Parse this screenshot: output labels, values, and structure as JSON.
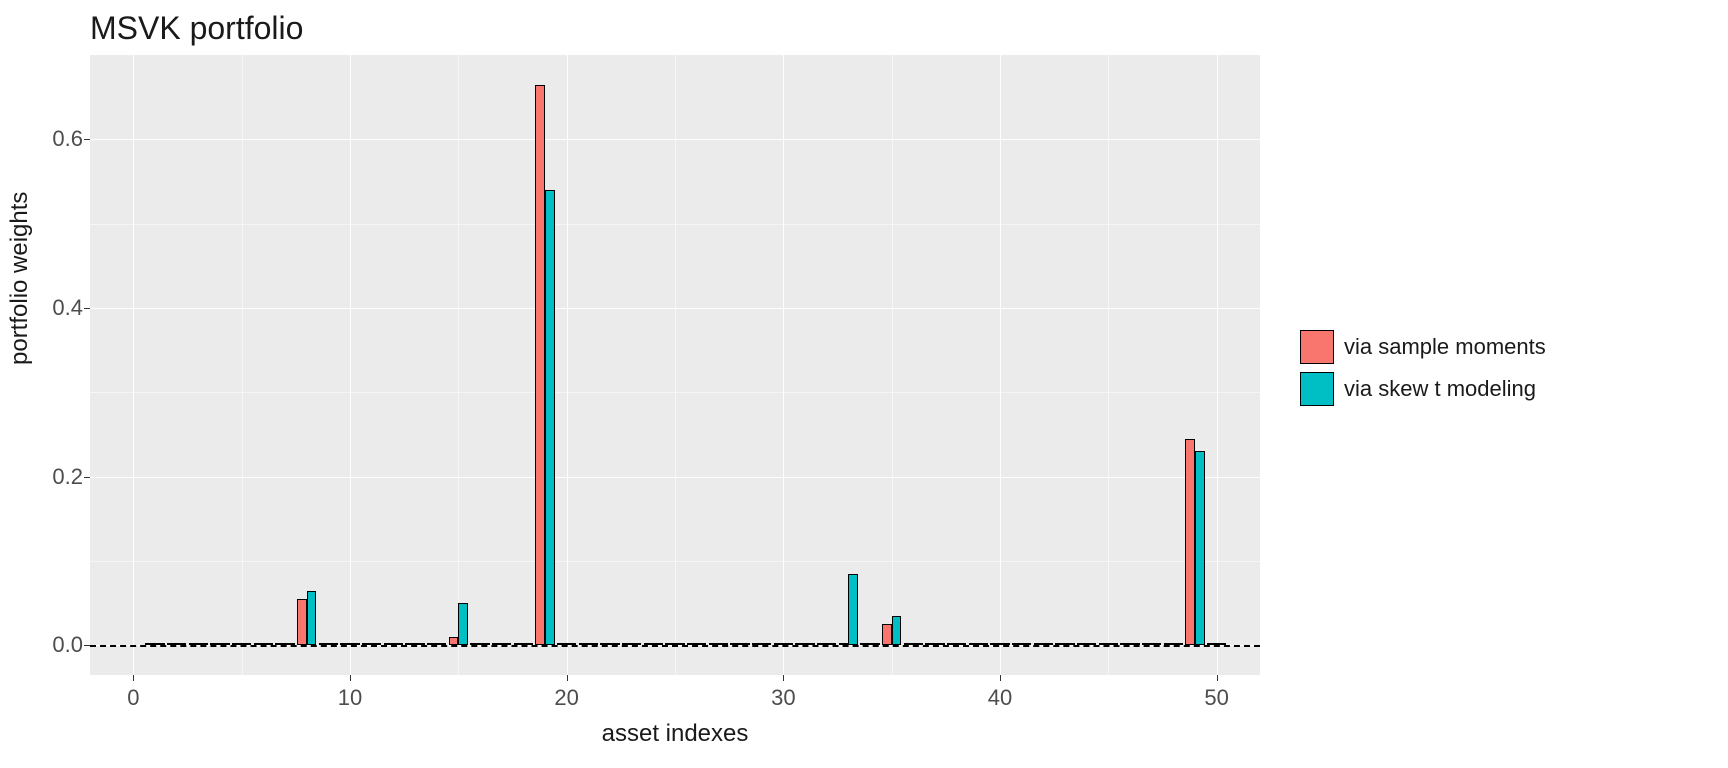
{
  "chart_data": {
    "type": "bar",
    "title": "MSVK portfolio",
    "xlabel": "asset indexes",
    "ylabel": "portfolio weights",
    "xlim": [
      -2,
      52
    ],
    "ylim": [
      -0.035,
      0.7
    ],
    "y_ticks": [
      0.0,
      0.2,
      0.4,
      0.6
    ],
    "x_ticks": [
      0,
      10,
      20,
      30,
      40,
      50
    ],
    "categories": [
      1,
      2,
      3,
      4,
      5,
      6,
      7,
      8,
      9,
      10,
      11,
      12,
      13,
      14,
      15,
      16,
      17,
      18,
      19,
      20,
      21,
      22,
      23,
      24,
      25,
      26,
      27,
      28,
      29,
      30,
      31,
      32,
      33,
      34,
      35,
      36,
      37,
      38,
      39,
      40,
      41,
      42,
      43,
      44,
      45,
      46,
      47,
      48,
      49,
      50
    ],
    "series": [
      {
        "name": "via sample moments",
        "color": "#f8766d",
        "values": [
          0,
          0,
          0,
          0,
          0,
          0,
          0,
          0.055,
          0,
          0,
          0,
          0,
          0,
          0,
          0.01,
          0,
          0,
          0,
          0.665,
          0,
          0,
          0,
          0,
          0,
          0,
          0,
          0,
          0,
          0,
          0,
          0,
          0,
          0,
          0,
          0.025,
          0,
          0,
          0,
          0,
          0,
          0,
          0,
          0,
          0,
          0,
          0,
          0,
          0,
          0.245,
          0
        ]
      },
      {
        "name": "via skew t modeling",
        "color": "#00bfc4",
        "values": [
          0,
          0,
          0,
          0,
          0,
          0,
          0,
          0.065,
          0,
          0,
          0,
          0,
          0,
          0,
          0.05,
          0,
          0,
          0,
          0.54,
          0,
          0,
          0,
          0,
          0,
          0,
          0,
          0,
          0,
          0,
          0,
          0,
          0,
          0.085,
          0,
          0.035,
          0,
          0,
          0,
          0,
          0,
          0,
          0,
          0,
          0,
          0,
          0,
          0,
          0,
          0.23,
          0
        ]
      }
    ]
  },
  "legend": {
    "items": [
      {
        "label": "via sample moments"
      },
      {
        "label": "via skew t modeling"
      }
    ]
  },
  "axis_tick_labels": {
    "y": [
      "0.0",
      "0.2",
      "0.4",
      "0.6"
    ],
    "x": [
      "0",
      "10",
      "20",
      "30",
      "40",
      "50"
    ]
  }
}
